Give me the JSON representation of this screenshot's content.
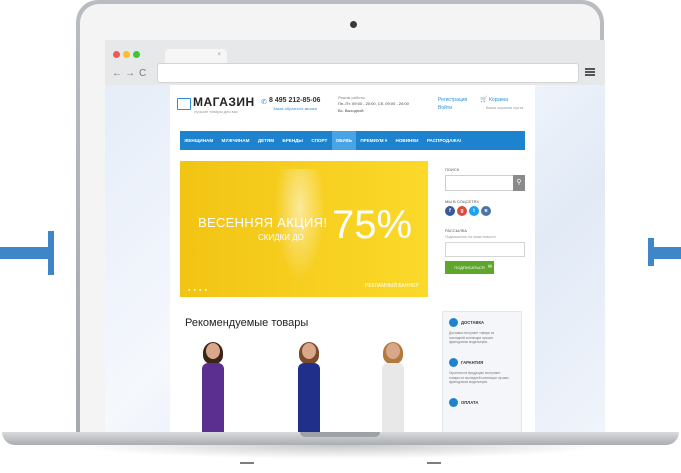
{
  "browser": {
    "tab_close": "×",
    "nav_back": "←",
    "nav_forward": "→",
    "nav_reload": "C",
    "traffic_colors": [
      "#ee5b56",
      "#f5bf2d",
      "#3fc33b"
    ]
  },
  "header": {
    "logo": "МАГАЗИН",
    "tagline": "лучшие товары для вас",
    "phone": "8 495 212-85-06",
    "callback": "Заказ обратного звонка",
    "hours_label": "Режим работы",
    "hours": "Пн.-Пт. 09:00 - 20:00, Сб. 09:00 - 20:00",
    "hours_off": "Вс. Выходной",
    "register": "Регистрация",
    "login": "Войти",
    "cart": "Корзина",
    "cart_status": "Ваша корзина пуста"
  },
  "nav": {
    "items": [
      "ЖЕНЩИНАМ",
      "МУЖЧИНАМ",
      "ДЕТЯМ",
      "БРЕНДЫ",
      "СПОРТ",
      "ОБУВЬ",
      "ПРЕМИУМ ▾",
      "НОВИНКИ",
      "РАСПРОДАЖА!"
    ],
    "active_index": 5
  },
  "banner": {
    "title": "ВЕСЕННЯЯ АКЦИЯ!",
    "subtitle": "СКИДКИ ДО",
    "percent": "75%",
    "caption": "РЕКЛАМНЫЙ БАННЕР",
    "dots": "● ● ● ●"
  },
  "sidebar": {
    "search_label": "ПОИСК",
    "search_icon": "⚲",
    "social_label": "МЫ В СОЦСЕТЯХ",
    "social": [
      {
        "icon": "facebook-icon",
        "glyph": "f",
        "color": "#3b5998"
      },
      {
        "icon": "google-plus-icon",
        "glyph": "g",
        "color": "#dd4b39"
      },
      {
        "icon": "twitter-icon",
        "glyph": "t",
        "color": "#1da1f2"
      },
      {
        "icon": "vk-icon",
        "glyph": "в",
        "color": "#4c75a3"
      }
    ],
    "newsletter_label": "РАССЫЛКА",
    "newsletter_sub": "Подпишитесь на наши новости",
    "subscribe": "ПОДПИСАТЬСЯ",
    "subscribe_icon": "✉"
  },
  "featured": {
    "title": "Рекомендуемые товары",
    "models": [
      {
        "hair": "#3b2418",
        "dress": "#5b2f8f"
      },
      {
        "hair": "#7a4a2a",
        "dress": "#1f2f8a"
      },
      {
        "hair": "#b27a3f",
        "dress": "#e8e8e8"
      }
    ]
  },
  "features": {
    "items": [
      {
        "title": "ДОСТАВКА",
        "text": "Доставка поступает товары из последней коллекции лучших французских модельеров."
      },
      {
        "title": "ГАРАНТИЯ",
        "text": "Гарантия на продукцию поступают товары из последней коллекции лучших французских модельеров."
      },
      {
        "title": "ОПЛАТА",
        "text": ""
      }
    ]
  }
}
